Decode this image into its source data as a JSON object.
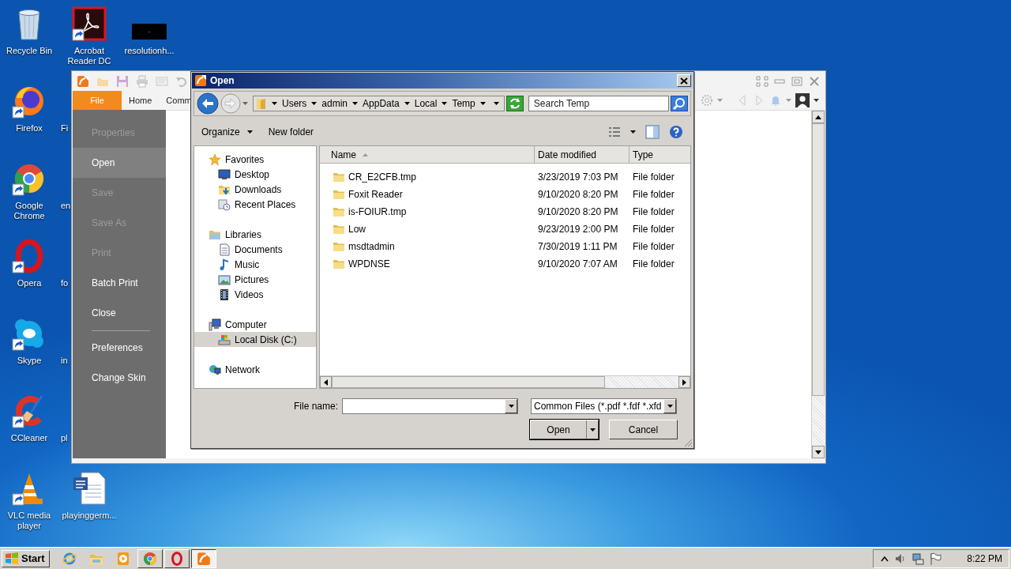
{
  "desktop": {
    "columns": [
      [
        {
          "label": "Recycle Bin",
          "kind": "recycle_bin",
          "shortcut": false
        },
        {
          "label": "Firefox",
          "kind": "firefox",
          "shortcut": true
        },
        {
          "label": "Google Chrome",
          "kind": "chrome",
          "shortcut": true
        },
        {
          "label": "Opera",
          "kind": "opera",
          "shortcut": true
        },
        {
          "label": "Skype",
          "kind": "skype",
          "shortcut": true
        },
        {
          "label": "CCleaner",
          "kind": "ccleaner",
          "shortcut": true
        },
        {
          "label": "VLC media player",
          "kind": "vlc",
          "shortcut": true
        }
      ],
      [
        {
          "label": "Acrobat Reader DC",
          "kind": "pdf_reader",
          "shortcut": true
        },
        {
          "label": "Fi",
          "kind": "covered"
        },
        {
          "label": "en",
          "kind": "covered"
        },
        {
          "label": "fo",
          "kind": "covered"
        },
        {
          "label": "in",
          "kind": "covered"
        },
        {
          "label": "pl",
          "kind": "covered"
        },
        {
          "label": "playinggerm...",
          "kind": "word_doc",
          "shortcut": false
        }
      ],
      [
        {
          "label": "resolutionh...",
          "kind": "image_file",
          "shortcut": false
        }
      ]
    ]
  },
  "reader": {
    "tabs": [
      {
        "label": "File",
        "selected": true
      },
      {
        "label": "Home",
        "selected": false
      },
      {
        "label": "Comm",
        "selected": false
      }
    ],
    "file_menu": [
      {
        "kind": "item",
        "label": "Properties",
        "disabled": true,
        "selected": false
      },
      {
        "kind": "item",
        "label": "Open",
        "disabled": false,
        "selected": true
      },
      {
        "kind": "item",
        "label": "Save",
        "disabled": true,
        "selected": false
      },
      {
        "kind": "item",
        "label": "Save As",
        "disabled": true,
        "selected": false
      },
      {
        "kind": "item",
        "label": "Print",
        "disabled": true,
        "selected": false
      },
      {
        "kind": "item",
        "label": "Batch Print",
        "disabled": false,
        "selected": false
      },
      {
        "kind": "item",
        "label": "Close",
        "disabled": false,
        "selected": false
      },
      {
        "kind": "separator"
      },
      {
        "kind": "item",
        "label": "Preferences",
        "disabled": false,
        "selected": false
      },
      {
        "kind": "item",
        "label": "Change Skin",
        "disabled": false,
        "selected": false
      }
    ]
  },
  "dialog": {
    "title": "Open",
    "breadcrumb": [
      "Users",
      "admin",
      "AppData",
      "Local",
      "Temp"
    ],
    "search": {
      "placeholder": "Search Temp"
    },
    "toolbar": [
      {
        "label": "Organize",
        "dropdown": true
      },
      {
        "label": "New folder",
        "dropdown": false
      }
    ],
    "nav": [
      {
        "label": "Favorites",
        "kind": "star",
        "selected": false,
        "children": [
          {
            "label": "Desktop",
            "kind": "desktop",
            "selected": false
          },
          {
            "label": "Downloads",
            "kind": "downloads",
            "selected": false
          },
          {
            "label": "Recent Places",
            "kind": "recent",
            "selected": false
          }
        ]
      },
      {
        "label": "Libraries",
        "kind": "library",
        "selected": false,
        "children": [
          {
            "label": "Documents",
            "kind": "documents",
            "selected": false
          },
          {
            "label": "Music",
            "kind": "music",
            "selected": false
          },
          {
            "label": "Pictures",
            "kind": "pictures",
            "selected": false
          },
          {
            "label": "Videos",
            "kind": "videos",
            "selected": false
          }
        ]
      },
      {
        "label": "Computer",
        "kind": "computer",
        "selected": false,
        "children": [
          {
            "label": "Local Disk (C:)",
            "kind": "drive",
            "selected": true
          }
        ]
      },
      {
        "label": "Network",
        "kind": "network",
        "selected": false
      }
    ],
    "columns": [
      {
        "label": "Name",
        "sorted": true
      },
      {
        "label": "Date modified",
        "sorted": false
      },
      {
        "label": "Type",
        "sorted": false
      }
    ],
    "rows": [
      {
        "name": "CR_E2CFB.tmp",
        "date": "3/23/2019 7:03 PM",
        "type": "File folder",
        "selected": false
      },
      {
        "name": "Foxit Reader",
        "date": "9/10/2020 8:20 PM",
        "type": "File folder",
        "selected": false
      },
      {
        "name": "is-FOIUR.tmp",
        "date": "9/10/2020 8:20 PM",
        "type": "File folder",
        "selected": false
      },
      {
        "name": "Low",
        "date": "9/23/2019 2:00 PM",
        "type": "File folder",
        "selected": false
      },
      {
        "name": "msdtadmin",
        "date": "7/30/2019 1:11 PM",
        "type": "File folder",
        "selected": false
      },
      {
        "name": "WPDNSE",
        "date": "9/10/2020 7:07 AM",
        "type": "File folder",
        "selected": false
      }
    ],
    "file_name": {
      "label": "File name:"
    },
    "filter": {
      "value": "Common Files (*.pdf *.fdf *.xfd"
    },
    "buttons": [
      {
        "label": "Open",
        "kind": "split"
      },
      {
        "label": "Cancel",
        "kind": "plain"
      }
    ]
  },
  "taskbar": {
    "start": "Start",
    "apps": [
      {
        "kind": "ie",
        "running": false,
        "active": false
      },
      {
        "kind": "explorer",
        "running": false,
        "active": false
      },
      {
        "kind": "media",
        "running": false,
        "active": false
      },
      {
        "kind": "chrome",
        "running": true,
        "active": false
      },
      {
        "kind": "opera",
        "running": true,
        "active": false
      },
      {
        "kind": "reader",
        "running": true,
        "active": true
      }
    ],
    "clock": "8:22 PM"
  }
}
